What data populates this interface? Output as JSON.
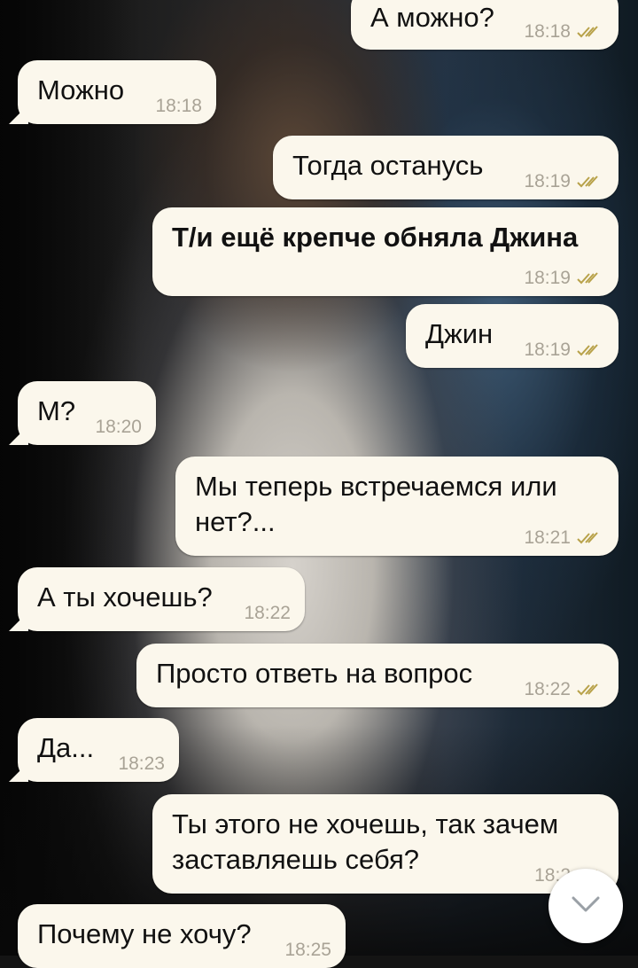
{
  "chat": {
    "messages": [
      {
        "direction": "out",
        "text": "А можно?",
        "time": "18:18",
        "status": "read"
      },
      {
        "direction": "in",
        "text": "Можно",
        "time": "18:18"
      },
      {
        "direction": "out",
        "text": "Тогда останусь",
        "time": "18:19",
        "status": "read"
      },
      {
        "direction": "out",
        "text": "Т/и ещё крепче обняла Джина",
        "time": "18:19",
        "status": "read"
      },
      {
        "direction": "out",
        "text": "Джин",
        "time": "18:19",
        "status": "read"
      },
      {
        "direction": "in",
        "text": "М?",
        "time": "18:20"
      },
      {
        "direction": "out",
        "text": "Мы теперь встречаемся или нет?...",
        "line1": "Мы теперь встречаемся или",
        "line2": "нет?...",
        "time": "18:21",
        "status": "read"
      },
      {
        "direction": "in",
        "text": "А ты хочешь?",
        "time": "18:22"
      },
      {
        "direction": "out",
        "text": "Просто ответь на вопрос",
        "time": "18:22",
        "status": "read"
      },
      {
        "direction": "in",
        "text": "Да...",
        "time": "18:23"
      },
      {
        "direction": "out",
        "text": "Ты этого не хочешь, так зачем заставляешь себя?",
        "line1": "Ты этого не хочешь, так зачем",
        "line2": "заставляешь себя?",
        "time": "18:2",
        "status": "read"
      },
      {
        "direction": "in",
        "text": "Почему не хочу?",
        "time": "18:25"
      }
    ]
  },
  "icons": {
    "read_receipt": "double-check-icon",
    "scroll_down": "chevron-down-icon"
  },
  "colors": {
    "bubble": "#fbf7ec",
    "time": "#a9a396",
    "check": "#b8a24a"
  }
}
